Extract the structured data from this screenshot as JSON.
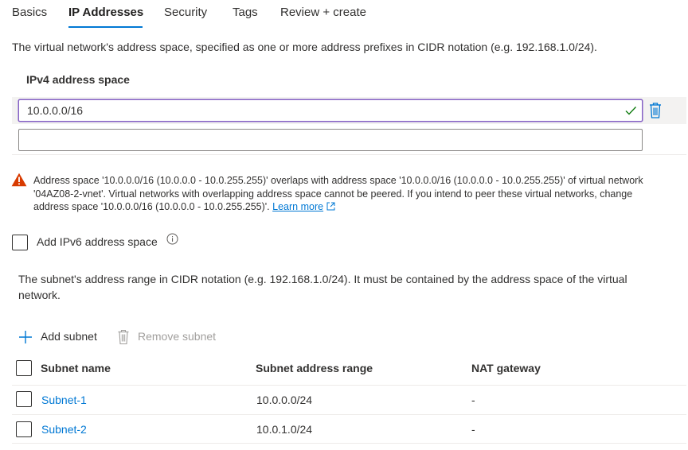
{
  "tabs": [
    {
      "label": "Basics"
    },
    {
      "label": "IP Addresses"
    },
    {
      "label": "Security"
    },
    {
      "label": "Tags"
    },
    {
      "label": "Review + create"
    }
  ],
  "active_tab": "IP Addresses",
  "address_space": {
    "description": "The virtual network's address space, specified as one or more address prefixes in CIDR notation (e.g. 192.168.1.0/24).",
    "label": "IPv4 address space",
    "values": [
      "10.0.0.0/16",
      ""
    ]
  },
  "warning": {
    "text": "Address space '10.0.0.0/16 (10.0.0.0 - 10.0.255.255)' overlaps with address space '10.0.0.0/16 (10.0.0.0 - 10.0.255.255)' of virtual network '04AZ08-2-vnet'. Virtual networks with overlapping address space cannot be peered. If you intend to peer these virtual networks, change address space '10.0.0.0/16 (10.0.0.0 - 10.0.255.255)'.",
    "link": "Learn more"
  },
  "ipv6": {
    "label": "Add IPv6 address space",
    "checked": false
  },
  "subnet": {
    "description": "The subnet's address range in CIDR notation (e.g. 192.168.1.0/24). It must be contained by the address space of the virtual network.",
    "add_label": "Add subnet",
    "remove_label": "Remove subnet",
    "columns": [
      "Subnet name",
      "Subnet address range",
      "NAT gateway"
    ],
    "rows": [
      {
        "name": "Subnet-1",
        "range": "10.0.0.0/24",
        "nat": "-"
      },
      {
        "name": "Subnet-2",
        "range": "10.0.1.0/24",
        "nat": "-"
      }
    ]
  },
  "colors": {
    "accent": "#0078d4",
    "focus_border": "#8661c5",
    "valid_check": "#107c10",
    "warning": "#d83b01"
  }
}
